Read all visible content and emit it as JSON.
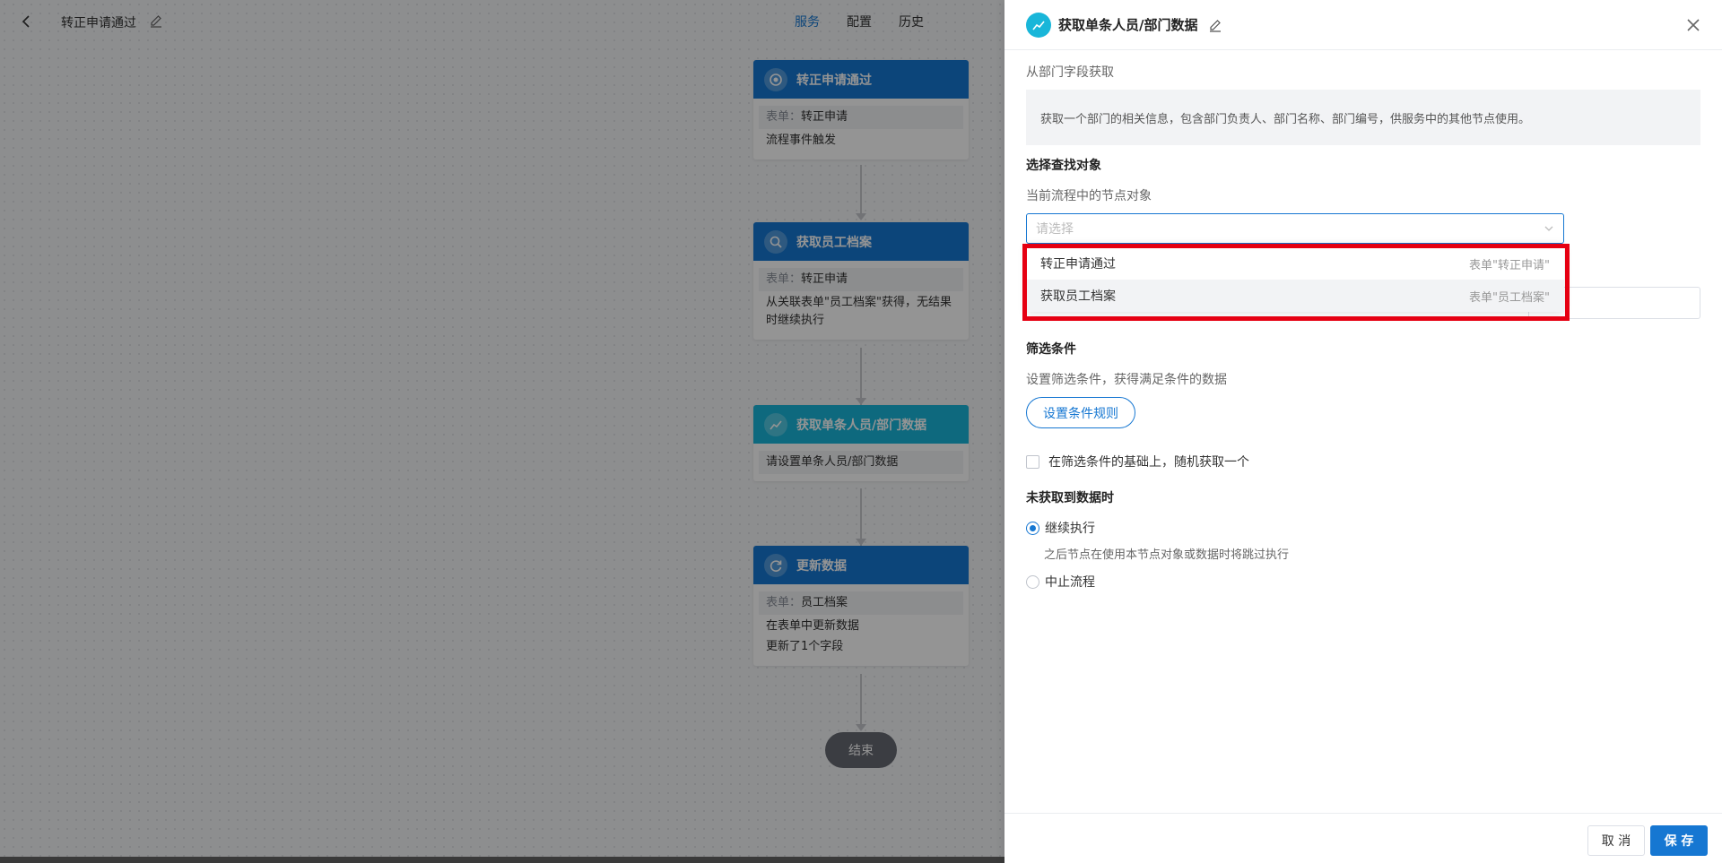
{
  "topbar": {
    "title": "转正申请通过",
    "tabs": [
      {
        "label": "服务",
        "active": true
      },
      {
        "label": "配置",
        "active": false
      },
      {
        "label": "历史",
        "active": false
      }
    ]
  },
  "nodes": [
    {
      "title": "转正申请通过",
      "icon": "target-icon",
      "lines": [
        {
          "label": "表单：",
          "value": "转正申请"
        },
        {
          "label": "",
          "value": "流程事件触发"
        }
      ]
    },
    {
      "title": "获取员工档案",
      "icon": "search-icon",
      "lines": [
        {
          "label": "表单：",
          "value": "转正申请"
        },
        {
          "label": "",
          "value": "从关联表单\"员工档案\"获得，无结果时继续执行"
        }
      ]
    },
    {
      "title": "获取单条人员/部门数据",
      "icon": "line-chart-icon",
      "lines": [
        {
          "label": "",
          "value": "请设置单条人员/部门数据"
        }
      ]
    },
    {
      "title": "更新数据",
      "icon": "refresh-icon",
      "lines": [
        {
          "label": "表单：",
          "value": "员工档案"
        },
        {
          "label": "",
          "value": "在表单中更新数据"
        },
        {
          "label": "",
          "value": "更新了1个字段"
        }
      ]
    }
  ],
  "end_label": "结束",
  "drawer": {
    "title": "获取单条人员/部门数据",
    "source_note": "从部门字段获取",
    "description": "获取一个部门的相关信息，包含部门负责人、部门名称、部门编号，供服务中的其他节点使用。",
    "select_target_title": "选择查找对象",
    "select_target_hint": "当前流程中的节点对象",
    "select_placeholder": "请选择",
    "dropdown_options": [
      {
        "label": "转正申请通过",
        "sub": "表单\"转正申请\""
      },
      {
        "label": "获取员工档案",
        "sub": "表单\"员工档案\""
      }
    ],
    "filter_title": "筛选条件",
    "filter_hint": "设置筛选条件，获得满足条件的数据",
    "filter_button": "设置条件规则",
    "random_checkbox": "在筛选条件的基础上，随机获取一个",
    "nodata_title": "未获取到数据时",
    "option_continue": "继续执行",
    "option_continue_hint": "之后节点在使用本节点对象或数据时将跳过执行",
    "option_stop": "中止流程",
    "cancel_label": "取 消",
    "save_label": "保 存"
  },
  "colors": {
    "primary": "#1677d2",
    "cyan": "#19b6d9",
    "highlight": "#e60012"
  }
}
